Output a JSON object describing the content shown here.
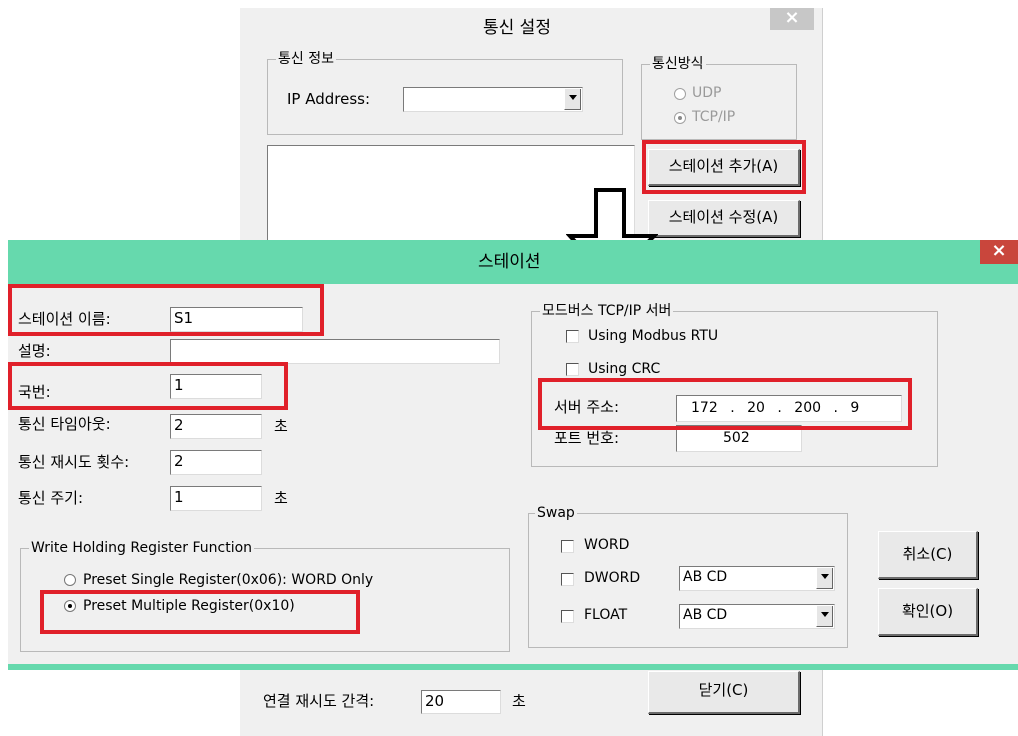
{
  "back_dialog": {
    "title": "통신 설정",
    "close_glyph": "×",
    "comm_info": {
      "label": "통신 정보",
      "ip_label": "IP Address:",
      "ip_value": ""
    },
    "comm_method": {
      "label": "통신방식",
      "udp": "UDP",
      "tcpip": "TCP/IP",
      "selected": "TCP/IP"
    },
    "add_station_button": "스테이션 추가(A)",
    "edit_station_button": "스테이션 수정(A)",
    "reconnect_label": "연결 재시도 간격:",
    "reconnect_value": "20",
    "reconnect_unit": "초",
    "close_button": "닫기(C)"
  },
  "station_dialog": {
    "title": "스테이션",
    "close_glyph": "×",
    "accent_color": "#66d9ad",
    "fields": {
      "name_label": "스테이션 이름:",
      "name_value": "S1",
      "desc_label": "설명:",
      "desc_value": "",
      "num_label": "국번:",
      "num_value": "1",
      "timeout_label": "통신 타임아웃:",
      "timeout_value": "2",
      "timeout_unit": "초",
      "retry_label": "통신 재시도 횟수:",
      "retry_value": "2",
      "period_label": "통신 주기:",
      "period_value": "1",
      "period_unit": "초"
    },
    "write_group": {
      "label": "Write Holding Register Function",
      "single": "Preset Single Register(0x06): WORD Only",
      "multiple": "Preset Multiple Register(0x10)",
      "selected": "multiple"
    },
    "modbus_group": {
      "label": "모드버스 TCP/IP 서버",
      "rtu": "Using Modbus RTU",
      "crc": "Using CRC",
      "server_label": "서버 주소:",
      "ip": [
        "172",
        "20",
        "200",
        "9"
      ],
      "ip_dot": ".",
      "port_label": "포트 번호:",
      "port_value": "502"
    },
    "swap_group": {
      "label": "Swap",
      "word": "WORD",
      "dword": "DWORD",
      "dword_value": "AB CD",
      "float": "FLOAT",
      "float_value": "AB CD"
    },
    "cancel_button": "취소(C)",
    "ok_button": "확인(O)"
  }
}
